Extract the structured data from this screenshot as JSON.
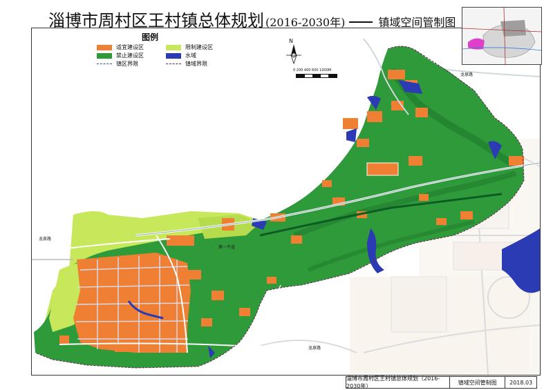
{
  "map": {
    "title_main": "淄博市周村区王村镇总体规划",
    "title_years": "(2016-2030年)",
    "title_sub": "镇域空间管制图",
    "legend_heading": "图例",
    "legend": [
      {
        "label": "适宜建设区",
        "color": "#ee7f33"
      },
      {
        "label": "限制建设区",
        "color": "#c7e85a"
      },
      {
        "label": "禁止建设区",
        "color": "#2f9a3a"
      },
      {
        "label": "水域",
        "color": "#2b3bb3"
      },
      {
        "label": "镇区界限"
      },
      {
        "label": "镇域界限"
      }
    ],
    "north_label": "N",
    "scale_labels": "0   200  400  600        1000M",
    "footer": {
      "plan_name": "淄博市周村区王村镇总体规划（2016-2030年）",
      "map_name": "镇域空间管制图",
      "date": "2018.03"
    },
    "road_labels": [
      "龙泉路",
      "龙泉路",
      "第一干道",
      "龙泉路"
    ]
  }
}
